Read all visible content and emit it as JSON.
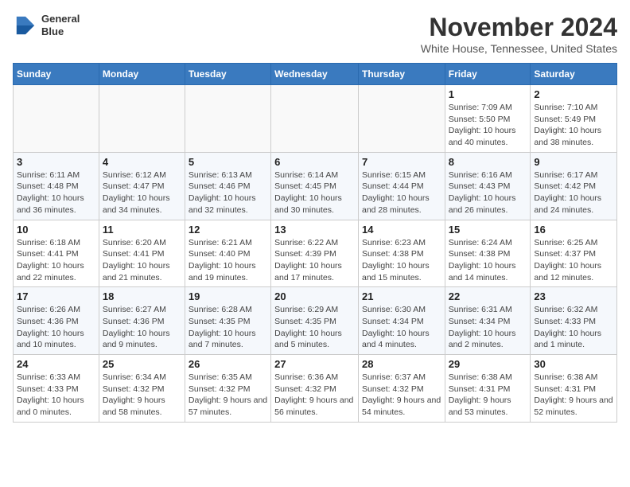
{
  "header": {
    "logo_line1": "General",
    "logo_line2": "Blue",
    "month": "November 2024",
    "location": "White House, Tennessee, United States"
  },
  "weekdays": [
    "Sunday",
    "Monday",
    "Tuesday",
    "Wednesday",
    "Thursday",
    "Friday",
    "Saturday"
  ],
  "weeks": [
    [
      {
        "day": "",
        "info": ""
      },
      {
        "day": "",
        "info": ""
      },
      {
        "day": "",
        "info": ""
      },
      {
        "day": "",
        "info": ""
      },
      {
        "day": "",
        "info": ""
      },
      {
        "day": "1",
        "info": "Sunrise: 7:09 AM\nSunset: 5:50 PM\nDaylight: 10 hours and 40 minutes."
      },
      {
        "day": "2",
        "info": "Sunrise: 7:10 AM\nSunset: 5:49 PM\nDaylight: 10 hours and 38 minutes."
      }
    ],
    [
      {
        "day": "3",
        "info": "Sunrise: 6:11 AM\nSunset: 4:48 PM\nDaylight: 10 hours and 36 minutes."
      },
      {
        "day": "4",
        "info": "Sunrise: 6:12 AM\nSunset: 4:47 PM\nDaylight: 10 hours and 34 minutes."
      },
      {
        "day": "5",
        "info": "Sunrise: 6:13 AM\nSunset: 4:46 PM\nDaylight: 10 hours and 32 minutes."
      },
      {
        "day": "6",
        "info": "Sunrise: 6:14 AM\nSunset: 4:45 PM\nDaylight: 10 hours and 30 minutes."
      },
      {
        "day": "7",
        "info": "Sunrise: 6:15 AM\nSunset: 4:44 PM\nDaylight: 10 hours and 28 minutes."
      },
      {
        "day": "8",
        "info": "Sunrise: 6:16 AM\nSunset: 4:43 PM\nDaylight: 10 hours and 26 minutes."
      },
      {
        "day": "9",
        "info": "Sunrise: 6:17 AM\nSunset: 4:42 PM\nDaylight: 10 hours and 24 minutes."
      }
    ],
    [
      {
        "day": "10",
        "info": "Sunrise: 6:18 AM\nSunset: 4:41 PM\nDaylight: 10 hours and 22 minutes."
      },
      {
        "day": "11",
        "info": "Sunrise: 6:20 AM\nSunset: 4:41 PM\nDaylight: 10 hours and 21 minutes."
      },
      {
        "day": "12",
        "info": "Sunrise: 6:21 AM\nSunset: 4:40 PM\nDaylight: 10 hours and 19 minutes."
      },
      {
        "day": "13",
        "info": "Sunrise: 6:22 AM\nSunset: 4:39 PM\nDaylight: 10 hours and 17 minutes."
      },
      {
        "day": "14",
        "info": "Sunrise: 6:23 AM\nSunset: 4:38 PM\nDaylight: 10 hours and 15 minutes."
      },
      {
        "day": "15",
        "info": "Sunrise: 6:24 AM\nSunset: 4:38 PM\nDaylight: 10 hours and 14 minutes."
      },
      {
        "day": "16",
        "info": "Sunrise: 6:25 AM\nSunset: 4:37 PM\nDaylight: 10 hours and 12 minutes."
      }
    ],
    [
      {
        "day": "17",
        "info": "Sunrise: 6:26 AM\nSunset: 4:36 PM\nDaylight: 10 hours and 10 minutes."
      },
      {
        "day": "18",
        "info": "Sunrise: 6:27 AM\nSunset: 4:36 PM\nDaylight: 10 hours and 9 minutes."
      },
      {
        "day": "19",
        "info": "Sunrise: 6:28 AM\nSunset: 4:35 PM\nDaylight: 10 hours and 7 minutes."
      },
      {
        "day": "20",
        "info": "Sunrise: 6:29 AM\nSunset: 4:35 PM\nDaylight: 10 hours and 5 minutes."
      },
      {
        "day": "21",
        "info": "Sunrise: 6:30 AM\nSunset: 4:34 PM\nDaylight: 10 hours and 4 minutes."
      },
      {
        "day": "22",
        "info": "Sunrise: 6:31 AM\nSunset: 4:34 PM\nDaylight: 10 hours and 2 minutes."
      },
      {
        "day": "23",
        "info": "Sunrise: 6:32 AM\nSunset: 4:33 PM\nDaylight: 10 hours and 1 minute."
      }
    ],
    [
      {
        "day": "24",
        "info": "Sunrise: 6:33 AM\nSunset: 4:33 PM\nDaylight: 10 hours and 0 minutes."
      },
      {
        "day": "25",
        "info": "Sunrise: 6:34 AM\nSunset: 4:32 PM\nDaylight: 9 hours and 58 minutes."
      },
      {
        "day": "26",
        "info": "Sunrise: 6:35 AM\nSunset: 4:32 PM\nDaylight: 9 hours and 57 minutes."
      },
      {
        "day": "27",
        "info": "Sunrise: 6:36 AM\nSunset: 4:32 PM\nDaylight: 9 hours and 56 minutes."
      },
      {
        "day": "28",
        "info": "Sunrise: 6:37 AM\nSunset: 4:32 PM\nDaylight: 9 hours and 54 minutes."
      },
      {
        "day": "29",
        "info": "Sunrise: 6:38 AM\nSunset: 4:31 PM\nDaylight: 9 hours and 53 minutes."
      },
      {
        "day": "30",
        "info": "Sunrise: 6:38 AM\nSunset: 4:31 PM\nDaylight: 9 hours and 52 minutes."
      }
    ]
  ]
}
